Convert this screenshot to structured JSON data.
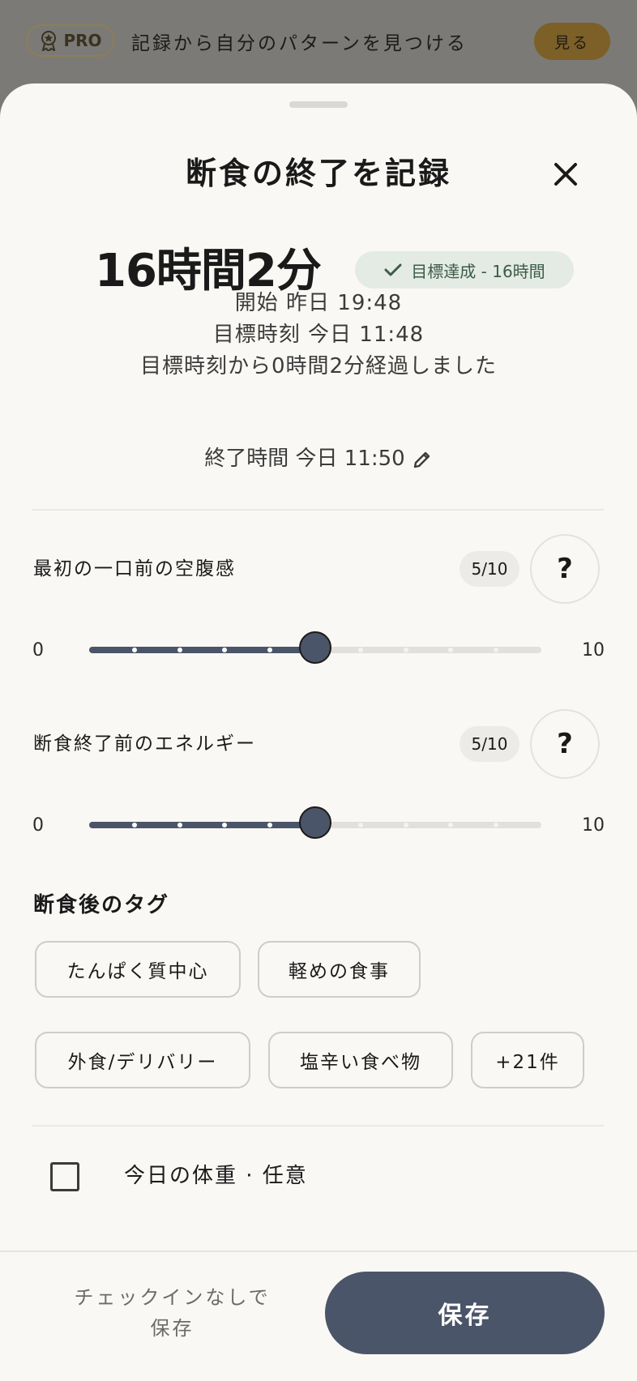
{
  "banner": {
    "pro_label": "PRO",
    "text": "記録から自分のパターンを見つける",
    "see_button": "見る"
  },
  "sheet": {
    "title": "断食の終了を記録",
    "duration": "16時間2分",
    "goal_chip": "目標達成 - 16時間",
    "start_line": "開始 昨日 19:48",
    "target_line": "目標時刻 今日 11:48",
    "elapsed_line": "目標時刻から0時間2分経過しました",
    "end_time": "終了時間 今日 11:50"
  },
  "sliders": [
    {
      "label": "最初の一口前の空腹感",
      "score_text": "5/10",
      "help": "?",
      "min_label": "0",
      "max_label": "10",
      "value": 5,
      "max": 10
    },
    {
      "label": "断食終了前のエネルギー",
      "score_text": "5/10",
      "help": "?",
      "min_label": "0",
      "max_label": "10",
      "value": 5,
      "max": 10
    }
  ],
  "tags_section": {
    "title": "断食後のタグ",
    "tags": [
      "たんぱく質中心",
      "軽めの食事",
      "外食/デリバリー",
      "塩辛い食べ物",
      "+21件"
    ]
  },
  "weight": {
    "label": "今日の体重 · 任意",
    "checked": false
  },
  "footer": {
    "skip_line1": "チェックインなしで",
    "skip_line2": "保存",
    "save_button": "保存"
  },
  "colors": {
    "accent": "#4b5569",
    "goal_chip_bg": "#e3ebe4",
    "goal_chip_text": "#3d5b48",
    "sheet_bg": "#faf8f4",
    "see_button": "#7c6027"
  }
}
